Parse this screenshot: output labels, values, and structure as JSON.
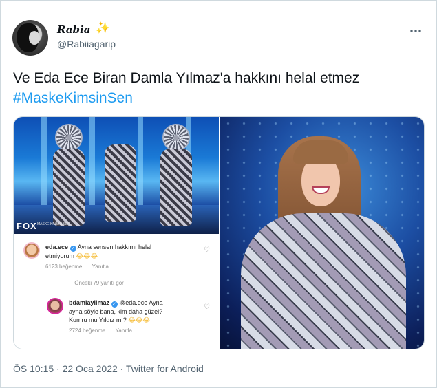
{
  "author": {
    "display_name": "Rabia",
    "sparkle_emoji": "✨",
    "handle": "@Rabiiagarip"
  },
  "menu": {
    "more_icon": "⋯"
  },
  "tweet": {
    "text": "Ve Eda Ece Biran Damla Yılmaz'a hakkını helal etmez",
    "hashtag": "#MaskeKimsinSen"
  },
  "media": {
    "left_image": {
      "channel_logo": "FOX",
      "show_tag": "MASKE KİMSİN SEN"
    },
    "comments": [
      {
        "user": "eda.ece",
        "text_line1": "Ayna sensen hakkımı helal",
        "text_line2": "etmiyorum",
        "emoji": "😂😂😂",
        "likes": "6123 beğenme",
        "reply": "Yanıtla"
      },
      {
        "user": "bdamlayilmaz",
        "mention": "@eda.ece Ayna",
        "text_line1": "ayna söyle bana, kim daha güzel?",
        "text_line2": "Kumru mu Yıldız mı?",
        "emoji": "😂😂😂",
        "likes": "2724 beğenme",
        "reply": "Yanıtla"
      }
    ],
    "view_replies": "Önceki 79 yanıtı gör"
  },
  "footer": {
    "timestamp": "ÖS 10:15 · 22 Oca 2022 · Twitter for Android"
  },
  "colors": {
    "accent": "#1d9bf0",
    "text_primary": "#0f1419",
    "text_secondary": "#536471"
  }
}
